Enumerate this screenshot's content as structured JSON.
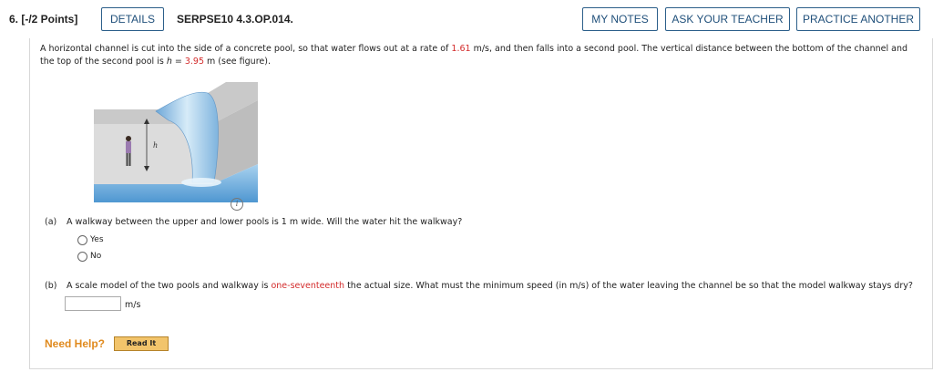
{
  "header": {
    "question_number": "6. [-/2 Points]",
    "details_label": "DETAILS",
    "code": "SERPSE10 4.3.OP.014.",
    "my_notes_label": "MY NOTES",
    "ask_teacher_label": "ASK YOUR TEACHER",
    "practice_label": "PRACTICE ANOTHER"
  },
  "problem": {
    "text_1": "A horizontal channel is cut into the side of a concrete pool, so that water flows out at a rate of ",
    "speed": "1.61",
    "text_2": " m/s, and then falls into a second pool. The vertical distance between the bottom of the channel and the top of the second pool is ",
    "h_var": "h",
    "text_3": " = ",
    "height": "3.95",
    "text_4": " m (see figure).",
    "figure_label": "h",
    "info_icon": "i"
  },
  "part_a": {
    "label": "(a)",
    "question": "A walkway between the upper and lower pools is 1 m wide. Will the water hit the walkway?",
    "options": [
      "Yes",
      "No"
    ]
  },
  "part_b": {
    "label": "(b)",
    "question_1": "A scale model of the two pools and walkway is ",
    "fraction": "one-seventeenth",
    "question_2": " the actual size. What must the minimum speed (in m/s) of the water leaving the channel be so that the model walkway stays dry?",
    "answer_value": "",
    "unit": "m/s"
  },
  "help": {
    "label": "Need Help?",
    "read_it_label": "Read It"
  },
  "colors": {
    "accent": "#1f4f7a",
    "highlight": "#d32b2b",
    "help": "#e08a1e"
  }
}
